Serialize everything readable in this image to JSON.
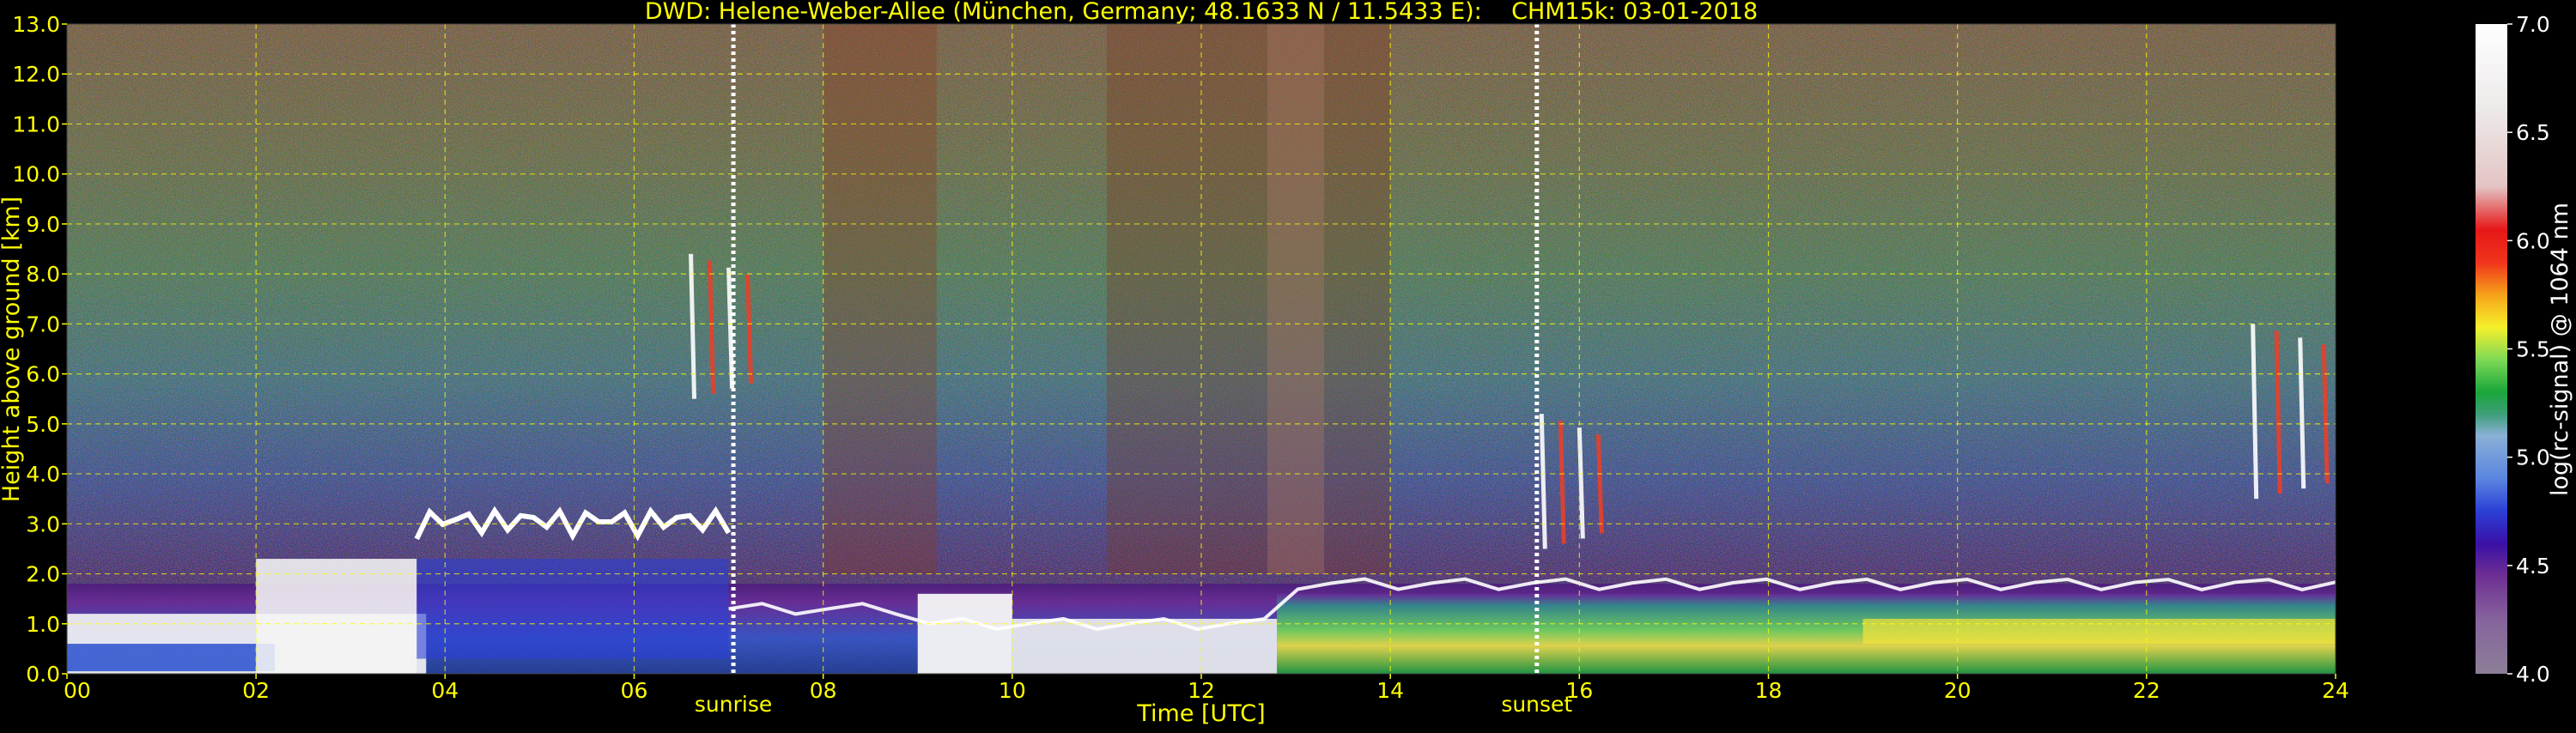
{
  "chart_data": {
    "type": "heatmap",
    "title": "DWD: Helene-Weber-Allee (München, Germany; 48.1633 N / 11.5433 E):    CHM15k: 03-01-2018",
    "xlabel": "Time [UTC]",
    "ylabel": "Height above ground [km]",
    "xlim": [
      0,
      24
    ],
    "ylim": [
      0,
      13
    ],
    "x_ticks": [
      "00",
      "02",
      "04",
      "06",
      "08",
      "10",
      "12",
      "14",
      "16",
      "18",
      "20",
      "22",
      "24"
    ],
    "x_tick_values": [
      0,
      2,
      4,
      6,
      8,
      10,
      12,
      14,
      16,
      18,
      20,
      22,
      24
    ],
    "y_ticks": [
      "0.0",
      "1.0",
      "2.0",
      "3.0",
      "4.0",
      "5.0",
      "6.0",
      "7.0",
      "8.0",
      "9.0",
      "10.0",
      "11.0",
      "12.0",
      "13.0"
    ],
    "y_tick_values": [
      0,
      1,
      2,
      3,
      4,
      5,
      6,
      7,
      8,
      9,
      10,
      11,
      12,
      13
    ],
    "grid": true,
    "annotations": [
      {
        "label": "sunrise",
        "x": 7.05
      },
      {
        "label": "sunset",
        "x": 15.55
      }
    ],
    "colorbar": {
      "label": "log(rc-signal) @ 1064 nm",
      "range": [
        4.0,
        7.0
      ],
      "ticks": [
        "4.0",
        "4.5",
        "5.0",
        "5.5",
        "6.0",
        "6.5",
        "7.0"
      ],
      "tick_values": [
        4.0,
        4.5,
        5.0,
        5.5,
        6.0,
        6.5,
        7.0
      ],
      "colors": [
        {
          "v": 4.0,
          "c": "#8c7f98"
        },
        {
          "v": 4.25,
          "c": "#86639c"
        },
        {
          "v": 4.45,
          "c": "#6e2f93"
        },
        {
          "v": 4.6,
          "c": "#3a10a6"
        },
        {
          "v": 4.75,
          "c": "#2b3fd6"
        },
        {
          "v": 4.9,
          "c": "#5a85df"
        },
        {
          "v": 5.1,
          "c": "#8ab0d6"
        },
        {
          "v": 5.2,
          "c": "#3d9e78"
        },
        {
          "v": 5.3,
          "c": "#19a63a"
        },
        {
          "v": 5.45,
          "c": "#7ed956"
        },
        {
          "v": 5.6,
          "c": "#f6f02a"
        },
        {
          "v": 5.75,
          "c": "#f7a21a"
        },
        {
          "v": 5.9,
          "c": "#f0341c"
        },
        {
          "v": 6.05,
          "c": "#e61717"
        },
        {
          "v": 6.25,
          "c": "#e4c4c4"
        },
        {
          "v": 6.6,
          "c": "#ede9e9"
        },
        {
          "v": 7.0,
          "c": "#ffffff"
        }
      ]
    },
    "features": [
      {
        "kind": "boundary layer",
        "x": [
          0,
          24
        ],
        "top_km": [
          1.7,
          1.8
        ]
      },
      {
        "kind": "aerosol layer",
        "x": [
          3.7,
          7.0
        ],
        "top_km": [
          2.5,
          3.3
        ]
      },
      {
        "kind": "cloud",
        "x": [
          6.5,
          7.3
        ],
        "height_km": [
          5.5,
          8.4
        ]
      },
      {
        "kind": "cloud",
        "x": [
          15.5,
          16.3
        ],
        "height_km": [
          2.5,
          5.2
        ]
      },
      {
        "kind": "cloud",
        "x": [
          23.0,
          24.0
        ],
        "height_km": [
          3.5,
          7.0
        ]
      },
      {
        "kind": "strong near-ground signal",
        "x": [
          0,
          3.8
        ],
        "height_km": [
          0,
          1.2
        ]
      },
      {
        "kind": "strong near-ground signal",
        "x": [
          9.0,
          10.0
        ],
        "height_km": [
          0,
          1.6
        ]
      }
    ]
  },
  "colors": {
    "text": "#ffff00",
    "grid": "#ffff00",
    "background": "#000000",
    "sun_marker": "#ffffff"
  }
}
